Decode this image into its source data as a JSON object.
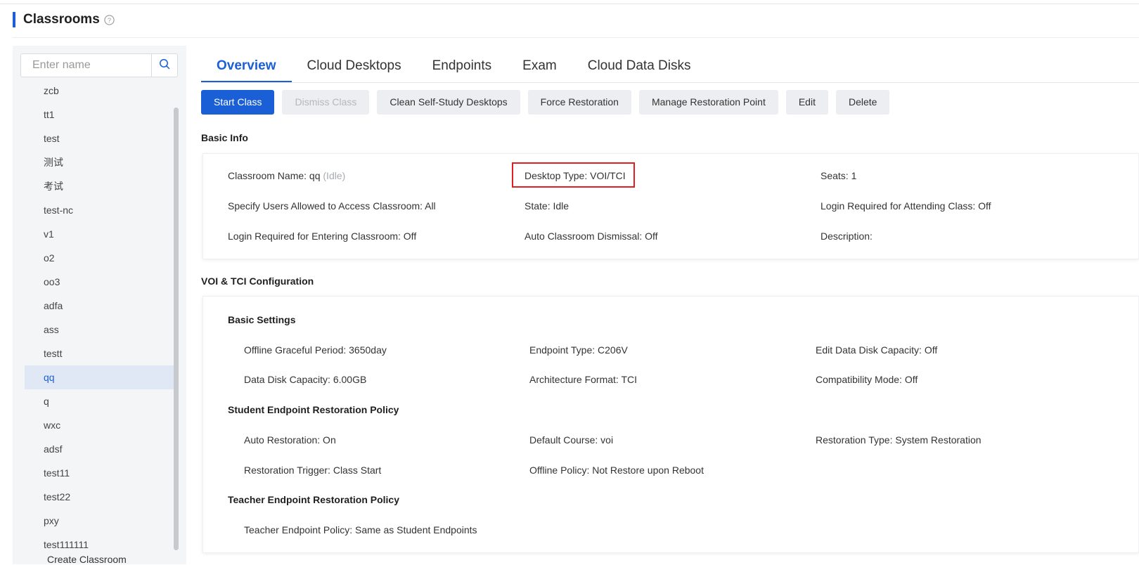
{
  "header": {
    "title": "Classrooms"
  },
  "sidebar": {
    "search_placeholder": "Enter name",
    "items": [
      {
        "label": "zcb"
      },
      {
        "label": "tt1"
      },
      {
        "label": "test"
      },
      {
        "label": "测试"
      },
      {
        "label": "考试"
      },
      {
        "label": "test-nc"
      },
      {
        "label": "v1"
      },
      {
        "label": "o2"
      },
      {
        "label": "oo3"
      },
      {
        "label": "adfa"
      },
      {
        "label": "ass"
      },
      {
        "label": "testt"
      },
      {
        "label": "qq"
      },
      {
        "label": "q"
      },
      {
        "label": "wxc"
      },
      {
        "label": "adsf"
      },
      {
        "label": "test11"
      },
      {
        "label": "test22"
      },
      {
        "label": "pxy"
      },
      {
        "label": "test111111"
      }
    ],
    "selected": "qq",
    "create_label": "Create Classroom"
  },
  "tabs": [
    {
      "label": "Overview"
    },
    {
      "label": "Cloud Desktops"
    },
    {
      "label": "Endpoints"
    },
    {
      "label": "Exam"
    },
    {
      "label": "Cloud Data Disks"
    }
  ],
  "toolbar": {
    "start_class": "Start Class",
    "dismiss_class": "Dismiss Class",
    "clean_desktops": "Clean Self-Study Desktops",
    "force_restoration": "Force Restoration",
    "manage_restoration_point": "Manage Restoration Point",
    "edit": "Edit",
    "delete": "Delete"
  },
  "basic_info": {
    "heading": "Basic Info",
    "classroom_name": "Classroom Name: qq",
    "classroom_status": "(Idle)",
    "desktop_type": "Desktop Type: VOI/TCI",
    "seats": "Seats: 1",
    "specify_users": "Specify Users Allowed to Access Classroom: All",
    "state": "State: Idle",
    "login_attending": "Login Required for Attending Class: Off",
    "login_entering": "Login Required for Entering Classroom: Off",
    "auto_dismissal": "Auto Classroom Dismissal: Off",
    "description": "Description:"
  },
  "voi_tci": {
    "heading": "VOI & TCI Configuration",
    "basic_settings": {
      "heading": "Basic Settings",
      "offline_grace": "Offline Graceful Period: 3650day",
      "endpoint_type": "Endpoint Type: C206V",
      "edit_disk_capacity": "Edit Data Disk Capacity: Off",
      "disk_capacity": "Data Disk Capacity: 6.00GB",
      "architecture": "Architecture Format: TCI",
      "compat_mode": "Compatibility Mode: Off"
    },
    "student_policy": {
      "heading": "Student Endpoint Restoration Policy",
      "auto_restoration": "Auto Restoration: On",
      "default_course": "Default Course: voi",
      "restoration_type": "Restoration Type: System Restoration",
      "restoration_trigger": "Restoration Trigger: Class Start",
      "offline_policy": "Offline Policy: Not Restore upon Reboot"
    },
    "teacher_policy": {
      "heading": "Teacher Endpoint Restoration Policy",
      "teacher_policy": "Teacher Endpoint Policy: Same as Student Endpoints"
    }
  },
  "colors": {
    "accent": "#1a5fd6",
    "highlight": "#e02020"
  },
  "icons": {
    "help": "help-circle-icon",
    "search": "search-icon"
  }
}
